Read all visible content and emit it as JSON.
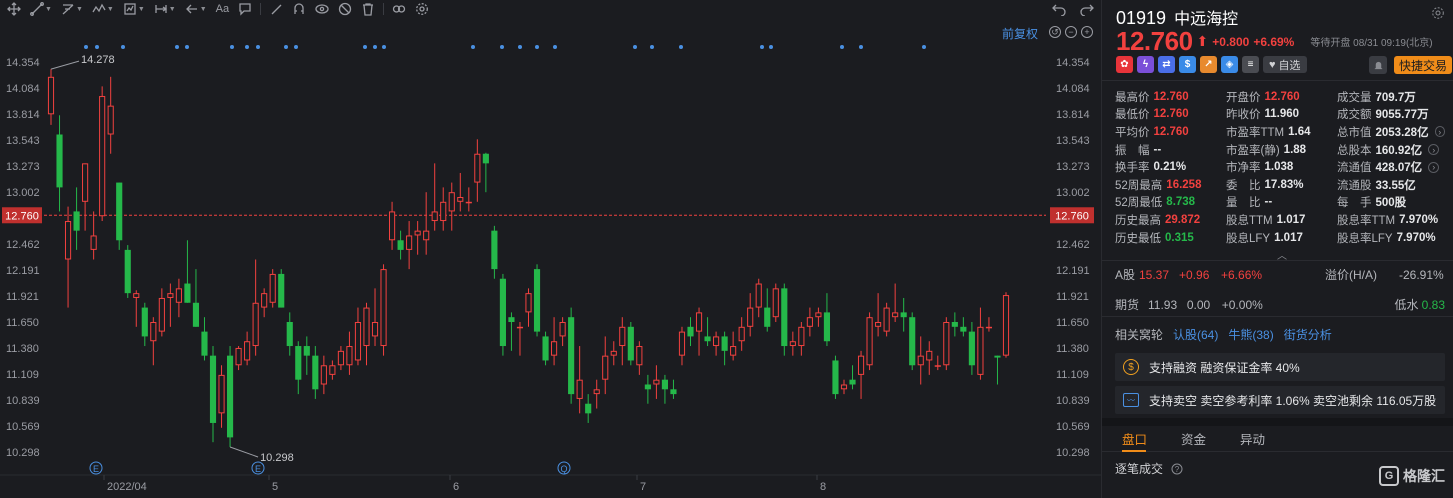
{
  "toolbar": {
    "tools": [
      "crosshair-icon",
      "trend-line-icon",
      "fib-icon",
      "pattern-icon",
      "measure-icon",
      "range-icon",
      "arrow-icon",
      "text-icon",
      "comment-icon",
      "pen-icon",
      "magnet-icon",
      "eye-icon",
      "hide-icon",
      "trash-icon",
      "link-icon",
      "settings-icon"
    ],
    "text_tool_label": "Aa"
  },
  "chart": {
    "adjust_label": "前复权",
    "price_axis": [
      "14.354",
      "14.084",
      "13.814",
      "13.543",
      "13.273",
      "13.002",
      "12.462",
      "12.191",
      "11.921",
      "11.650",
      "11.380",
      "11.109",
      "10.839",
      "10.569",
      "10.298"
    ],
    "current_price_tag": "12.760",
    "high_marker": "14.278",
    "low_marker": "10.298",
    "x_labels": [
      "2022/04",
      "5",
      "6",
      "7",
      "8"
    ],
    "event_markers": [
      "E",
      "E",
      "Q"
    ],
    "colors": {
      "up": "#f2413f",
      "down": "#25b84a",
      "dot": "#4a90e2",
      "hline": "#f2413f"
    }
  },
  "chart_data": {
    "type": "candlestick",
    "ylim": [
      10.2,
      14.43
    ],
    "current_price": 12.76,
    "candles": [
      {
        "o": 13.81,
        "h": 14.28,
        "l": 13.7,
        "c": 14.2
      },
      {
        "o": 13.6,
        "h": 13.8,
        "l": 12.8,
        "c": 13.05
      },
      {
        "o": 12.3,
        "h": 12.85,
        "l": 11.8,
        "c": 12.7
      },
      {
        "o": 12.8,
        "h": 13.05,
        "l": 12.4,
        "c": 12.6
      },
      {
        "o": 12.9,
        "h": 13.3,
        "l": 12.6,
        "c": 13.3
      },
      {
        "o": 12.4,
        "h": 12.8,
        "l": 12.3,
        "c": 12.55
      },
      {
        "o": 12.75,
        "h": 14.1,
        "l": 12.7,
        "c": 14.0
      },
      {
        "o": 13.6,
        "h": 14.2,
        "l": 13.4,
        "c": 13.9
      },
      {
        "o": 13.1,
        "h": 13.1,
        "l": 12.4,
        "c": 12.5
      },
      {
        "o": 12.4,
        "h": 12.45,
        "l": 11.9,
        "c": 11.95
      },
      {
        "o": 11.9,
        "h": 11.98,
        "l": 11.6,
        "c": 11.95
      },
      {
        "o": 11.8,
        "h": 11.85,
        "l": 11.4,
        "c": 11.5
      },
      {
        "o": 11.45,
        "h": 11.7,
        "l": 11.2,
        "c": 11.65
      },
      {
        "o": 11.55,
        "h": 12.0,
        "l": 11.5,
        "c": 11.9
      },
      {
        "o": 11.9,
        "h": 12.05,
        "l": 11.6,
        "c": 11.95
      },
      {
        "o": 11.85,
        "h": 12.1,
        "l": 11.7,
        "c": 12.0
      },
      {
        "o": 12.05,
        "h": 12.5,
        "l": 11.85,
        "c": 11.85
      },
      {
        "o": 11.85,
        "h": 12.2,
        "l": 11.6,
        "c": 11.6
      },
      {
        "o": 11.55,
        "h": 11.7,
        "l": 11.25,
        "c": 11.3
      },
      {
        "o": 11.3,
        "h": 11.4,
        "l": 10.4,
        "c": 10.6
      },
      {
        "o": 10.7,
        "h": 11.2,
        "l": 10.55,
        "c": 11.1
      },
      {
        "o": 11.3,
        "h": 11.4,
        "l": 10.35,
        "c": 10.45
      },
      {
        "o": 11.2,
        "h": 11.4,
        "l": 11.15,
        "c": 11.38
      },
      {
        "o": 11.25,
        "h": 11.55,
        "l": 11.2,
        "c": 11.45
      },
      {
        "o": 11.4,
        "h": 12.3,
        "l": 11.3,
        "c": 11.85
      },
      {
        "o": 11.8,
        "h": 12.0,
        "l": 11.7,
        "c": 11.95
      },
      {
        "o": 11.85,
        "h": 12.2,
        "l": 11.8,
        "c": 12.15
      },
      {
        "o": 12.15,
        "h": 12.2,
        "l": 11.8,
        "c": 11.8
      },
      {
        "o": 11.65,
        "h": 11.75,
        "l": 11.3,
        "c": 11.4
      },
      {
        "o": 11.4,
        "h": 11.45,
        "l": 10.9,
        "c": 11.05
      },
      {
        "o": 11.4,
        "h": 11.5,
        "l": 11.1,
        "c": 11.3
      },
      {
        "o": 11.3,
        "h": 11.4,
        "l": 10.85,
        "c": 10.95
      },
      {
        "o": 11.0,
        "h": 11.3,
        "l": 10.9,
        "c": 11.2
      },
      {
        "o": 11.1,
        "h": 11.25,
        "l": 11.05,
        "c": 11.2
      },
      {
        "o": 11.2,
        "h": 11.4,
        "l": 11.15,
        "c": 11.35
      },
      {
        "o": 11.2,
        "h": 11.55,
        "l": 11.1,
        "c": 11.4
      },
      {
        "o": 11.25,
        "h": 11.8,
        "l": 11.2,
        "c": 11.65
      },
      {
        "o": 11.4,
        "h": 11.85,
        "l": 11.2,
        "c": 11.8
      },
      {
        "o": 11.5,
        "h": 12.0,
        "l": 11.4,
        "c": 11.65
      },
      {
        "o": 11.4,
        "h": 12.25,
        "l": 11.3,
        "c": 12.2
      },
      {
        "o": 12.5,
        "h": 12.9,
        "l": 12.4,
        "c": 12.8
      },
      {
        "o": 12.5,
        "h": 12.6,
        "l": 12.3,
        "c": 12.4
      },
      {
        "o": 12.4,
        "h": 12.7,
        "l": 12.2,
        "c": 12.55
      },
      {
        "o": 12.55,
        "h": 12.7,
        "l": 12.35,
        "c": 12.6
      },
      {
        "o": 12.5,
        "h": 13.0,
        "l": 12.35,
        "c": 12.6
      },
      {
        "o": 12.7,
        "h": 13.3,
        "l": 12.6,
        "c": 12.8
      },
      {
        "o": 12.7,
        "h": 13.05,
        "l": 12.6,
        "c": 12.9
      },
      {
        "o": 12.8,
        "h": 13.1,
        "l": 12.6,
        "c": 13.0
      },
      {
        "o": 12.9,
        "h": 13.2,
        "l": 12.8,
        "c": 12.95
      },
      {
        "o": 12.9,
        "h": 13.05,
        "l": 12.8,
        "c": 12.9
      },
      {
        "o": 13.1,
        "h": 13.55,
        "l": 12.9,
        "c": 13.4
      },
      {
        "o": 13.4,
        "h": 13.41,
        "l": 13.0,
        "c": 13.3
      },
      {
        "o": 12.6,
        "h": 12.65,
        "l": 12.1,
        "c": 12.2
      },
      {
        "o": 12.1,
        "h": 12.15,
        "l": 11.3,
        "c": 11.4
      },
      {
        "o": 11.7,
        "h": 11.75,
        "l": 11.35,
        "c": 11.65
      },
      {
        "o": 11.6,
        "h": 11.65,
        "l": 11.3,
        "c": 11.6
      },
      {
        "o": 11.75,
        "h": 12.0,
        "l": 11.6,
        "c": 11.95
      },
      {
        "o": 12.2,
        "h": 12.25,
        "l": 11.5,
        "c": 11.55
      },
      {
        "o": 11.5,
        "h": 11.55,
        "l": 11.2,
        "c": 11.25
      },
      {
        "o": 11.3,
        "h": 11.7,
        "l": 11.2,
        "c": 11.45
      },
      {
        "o": 11.5,
        "h": 11.7,
        "l": 11.4,
        "c": 11.65
      },
      {
        "o": 11.7,
        "h": 11.8,
        "l": 10.8,
        "c": 10.9
      },
      {
        "o": 10.85,
        "h": 11.4,
        "l": 10.7,
        "c": 11.05
      },
      {
        "o": 10.8,
        "h": 10.9,
        "l": 10.6,
        "c": 10.7
      },
      {
        "o": 10.9,
        "h": 11.05,
        "l": 10.75,
        "c": 10.95
      },
      {
        "o": 11.05,
        "h": 11.5,
        "l": 10.9,
        "c": 11.3
      },
      {
        "o": 11.3,
        "h": 11.45,
        "l": 11.2,
        "c": 11.35
      },
      {
        "o": 11.4,
        "h": 11.7,
        "l": 11.2,
        "c": 11.6
      },
      {
        "o": 11.6,
        "h": 11.65,
        "l": 11.2,
        "c": 11.25
      },
      {
        "o": 11.2,
        "h": 11.45,
        "l": 11.1,
        "c": 11.4
      },
      {
        "o": 11.0,
        "h": 11.1,
        "l": 10.8,
        "c": 10.95
      },
      {
        "o": 11.0,
        "h": 11.2,
        "l": 10.85,
        "c": 11.05
      },
      {
        "o": 11.05,
        "h": 11.1,
        "l": 10.8,
        "c": 10.95
      },
      {
        "o": 10.95,
        "h": 11.05,
        "l": 10.85,
        "c": 10.9
      },
      {
        "o": 11.3,
        "h": 11.6,
        "l": 11.2,
        "c": 11.55
      },
      {
        "o": 11.6,
        "h": 11.7,
        "l": 11.4,
        "c": 11.5
      },
      {
        "o": 11.55,
        "h": 11.8,
        "l": 11.3,
        "c": 11.75
      },
      {
        "o": 11.5,
        "h": 11.7,
        "l": 11.4,
        "c": 11.45
      },
      {
        "o": 11.4,
        "h": 11.55,
        "l": 11.3,
        "c": 11.5
      },
      {
        "o": 11.5,
        "h": 11.55,
        "l": 11.2,
        "c": 11.35
      },
      {
        "o": 11.3,
        "h": 11.55,
        "l": 11.25,
        "c": 11.4
      },
      {
        "o": 11.45,
        "h": 11.7,
        "l": 11.35,
        "c": 11.6
      },
      {
        "o": 11.6,
        "h": 11.95,
        "l": 11.5,
        "c": 11.8
      },
      {
        "o": 11.8,
        "h": 12.1,
        "l": 11.7,
        "c": 12.05
      },
      {
        "o": 11.8,
        "h": 12.0,
        "l": 11.55,
        "c": 11.6
      },
      {
        "o": 11.7,
        "h": 12.05,
        "l": 11.65,
        "c": 12.0
      },
      {
        "o": 12.0,
        "h": 12.05,
        "l": 11.3,
        "c": 11.4
      },
      {
        "o": 11.4,
        "h": 11.55,
        "l": 11.3,
        "c": 11.45
      },
      {
        "o": 11.4,
        "h": 11.65,
        "l": 11.3,
        "c": 11.6
      },
      {
        "o": 11.6,
        "h": 11.8,
        "l": 11.5,
        "c": 11.7
      },
      {
        "o": 11.7,
        "h": 11.8,
        "l": 11.6,
        "c": 11.75
      },
      {
        "o": 11.75,
        "h": 11.95,
        "l": 11.4,
        "c": 11.45
      },
      {
        "o": 11.25,
        "h": 11.3,
        "l": 10.85,
        "c": 10.9
      },
      {
        "o": 10.95,
        "h": 11.05,
        "l": 10.9,
        "c": 11.0
      },
      {
        "o": 11.05,
        "h": 11.2,
        "l": 10.95,
        "c": 11.0
      },
      {
        "o": 11.1,
        "h": 11.35,
        "l": 10.85,
        "c": 11.3
      },
      {
        "o": 11.2,
        "h": 11.75,
        "l": 11.15,
        "c": 11.7
      },
      {
        "o": 11.6,
        "h": 11.95,
        "l": 11.5,
        "c": 11.65
      },
      {
        "o": 11.55,
        "h": 11.85,
        "l": 11.5,
        "c": 11.8
      },
      {
        "o": 11.7,
        "h": 12.05,
        "l": 11.65,
        "c": 11.75
      },
      {
        "o": 11.75,
        "h": 11.9,
        "l": 11.55,
        "c": 11.7
      },
      {
        "o": 11.7,
        "h": 11.75,
        "l": 11.15,
        "c": 11.2
      },
      {
        "o": 11.2,
        "h": 11.5,
        "l": 11.0,
        "c": 11.3
      },
      {
        "o": 11.25,
        "h": 11.45,
        "l": 11.1,
        "c": 11.35
      },
      {
        "o": 11.2,
        "h": 11.3,
        "l": 11.15,
        "c": 11.2
      },
      {
        "o": 11.2,
        "h": 11.7,
        "l": 11.15,
        "c": 11.65
      },
      {
        "o": 11.65,
        "h": 11.75,
        "l": 11.5,
        "c": 11.6
      },
      {
        "o": 11.6,
        "h": 11.7,
        "l": 11.5,
        "c": 11.55
      },
      {
        "o": 11.55,
        "h": 11.65,
        "l": 11.1,
        "c": 11.2
      },
      {
        "o": 11.1,
        "h": 11.8,
        "l": 11.05,
        "c": 11.6
      },
      {
        "o": 11.6,
        "h": 11.7,
        "l": 11.55,
        "c": 11.6
      },
      {
        "o": 11.3,
        "h": 11.3,
        "l": 11.0,
        "c": 11.28
      },
      {
        "o": 11.3,
        "h": 11.96,
        "l": 11.28,
        "c": 11.93
      }
    ]
  },
  "stock": {
    "code": "01919",
    "name": "中远海控",
    "price": "12.760",
    "arrow": "⬆",
    "change": "+0.800",
    "change_pct": "+6.69%",
    "status": "等待开盘 08/31 09:19(北京)",
    "watch_label": "自选",
    "trade_label": "快捷交易"
  },
  "stats": [
    {
      "label": "最高价",
      "value": "12.760",
      "tone": "red"
    },
    {
      "label": "开盘价",
      "value": "12.760",
      "tone": "red"
    },
    {
      "label": "成交量",
      "value": "709.7万",
      "tone": ""
    },
    {
      "label": "最低价",
      "value": "12.760",
      "tone": "red"
    },
    {
      "label": "昨收价",
      "value": "11.960",
      "tone": ""
    },
    {
      "label": "成交额",
      "value": "9055.77万",
      "tone": ""
    },
    {
      "label": "平均价",
      "value": "12.760",
      "tone": "red"
    },
    {
      "label": "市盈率TTM",
      "value": "1.64",
      "tone": ""
    },
    {
      "label": "总市值",
      "value": "2053.28亿",
      "tone": ""
    },
    {
      "label": "振　幅",
      "value": "--",
      "tone": ""
    },
    {
      "label": "市盈率(静)",
      "value": "1.88",
      "tone": ""
    },
    {
      "label": "总股本",
      "value": "160.92亿",
      "tone": ""
    },
    {
      "label": "换手率",
      "value": "0.21%",
      "tone": ""
    },
    {
      "label": "市净率",
      "value": "1.038",
      "tone": ""
    },
    {
      "label": "流通值",
      "value": "428.07亿",
      "tone": ""
    },
    {
      "label": "52周最高",
      "value": "16.258",
      "tone": "red"
    },
    {
      "label": "委　比",
      "value": "17.83%",
      "tone": ""
    },
    {
      "label": "流通股",
      "value": "33.55亿",
      "tone": ""
    },
    {
      "label": "52周最低",
      "value": "8.738",
      "tone": "green"
    },
    {
      "label": "量　比",
      "value": "--",
      "tone": ""
    },
    {
      "label": "每　手",
      "value": "500股",
      "tone": ""
    },
    {
      "label": "历史最高",
      "value": "29.872",
      "tone": "red"
    },
    {
      "label": "股息TTM",
      "value": "1.017",
      "tone": ""
    },
    {
      "label": "股息率TTM",
      "value": "7.970%",
      "tone": ""
    },
    {
      "label": "历史最低",
      "value": "0.315",
      "tone": "green"
    },
    {
      "label": "股息LFY",
      "value": "1.017",
      "tone": ""
    },
    {
      "label": "股息率LFY",
      "value": "7.970%",
      "tone": ""
    }
  ],
  "a_share": {
    "label": "A股",
    "price": "15.37",
    "change": "+0.96",
    "pct": "+6.66%",
    "premium_label": "溢价(H/A)",
    "premium": "-26.91%"
  },
  "futures": {
    "label": "期货",
    "price": "11.93",
    "change": "0.00",
    "pct": "+0.00%",
    "water_label": "低水",
    "water": "0.83"
  },
  "related": {
    "label": "相关窝轮",
    "links": [
      "认股(64)",
      "牛熊(38)",
      "街货分析"
    ]
  },
  "margin": {
    "text": "支持融资  融资保证金率 40%"
  },
  "short": {
    "text": "支持卖空  卖空参考利率 1.06%  卖空池剩余 116.05万股"
  },
  "tabs": [
    "盘口",
    "资金",
    "异动"
  ],
  "tick_label": "逐笔成交",
  "brand": "格隆汇"
}
